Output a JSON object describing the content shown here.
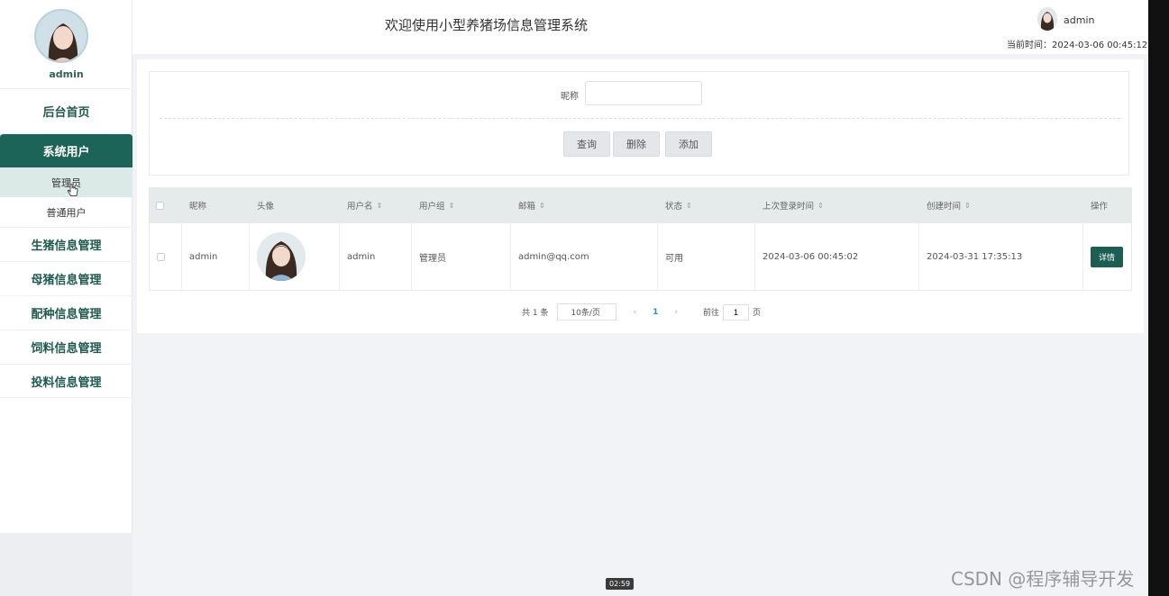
{
  "sidebar": {
    "username": "admin",
    "menu": {
      "home": "后台首页",
      "system_users": "系统用户",
      "admin_sub": "管理员",
      "normal_sub": "普通用户",
      "pig_info": "生猪信息管理",
      "sow_info": "母猪信息管理",
      "breeding_info": "配种信息管理",
      "feed_info": "饲料信息管理",
      "feeding_info": "投料信息管理"
    }
  },
  "header": {
    "title": "欢迎使用小型养猪场信息管理系统",
    "user": "admin",
    "time": "当前时间：2024-03-06 00:45:12"
  },
  "search": {
    "label": "昵称",
    "value": "",
    "query_btn": "查询",
    "delete_btn": "删除",
    "add_btn": "添加"
  },
  "table": {
    "headers": {
      "nickname": "昵称",
      "avatar": "头像",
      "username": "用户名",
      "group": "用户组",
      "email": "邮箱",
      "status": "状态",
      "last_login": "上次登录时间",
      "created": "创建时间",
      "ops": "操作"
    },
    "rows": [
      {
        "nickname": "admin",
        "username": "admin",
        "group": "管理员",
        "email": "admin@qq.com",
        "status": "可用",
        "last_login": "2024-03-06 00:45:02",
        "created": "2024-03-31 17:35:13",
        "detail": "详情"
      }
    ]
  },
  "pagination": {
    "total": "共 1 条",
    "page_size": "10条/页",
    "prev": "‹",
    "current": "1",
    "next": "›",
    "goto": "前往",
    "goto_value": "1",
    "page_unit": "页"
  },
  "video_time": "02:59",
  "watermark": "CSDN @程序辅导开发",
  "colors": {
    "accent": "#1d6458",
    "header_bg": "#ffffff",
    "page_bg": "#f1f3f7"
  }
}
